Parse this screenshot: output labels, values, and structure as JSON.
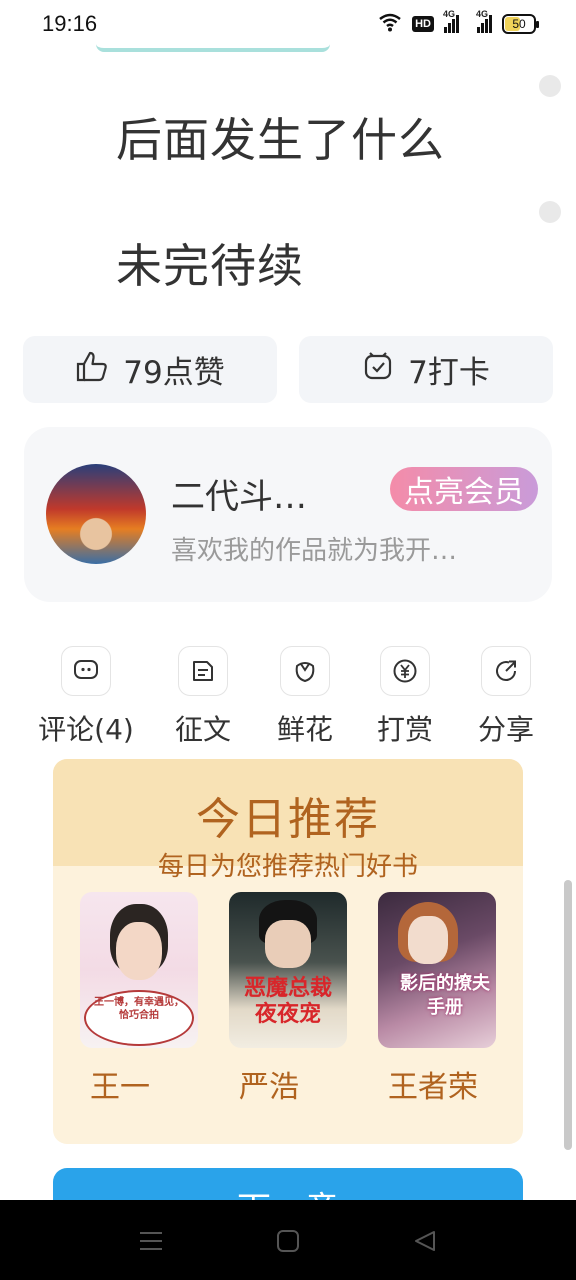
{
  "status_bar": {
    "time": "19:16",
    "hd": "HD",
    "net1": "4G",
    "net2": "4G",
    "battery": "50"
  },
  "story": {
    "line1": "后面发生了什么",
    "line2": "未完待续"
  },
  "actions": {
    "like_label": "79点赞",
    "checkin_label": "7打卡"
  },
  "author": {
    "name": "二代斗…",
    "subtitle": "喜欢我的作品就为我开…",
    "vip_label": "点亮会员"
  },
  "tools": [
    {
      "label": "评论(4)",
      "icon": "comment-icon"
    },
    {
      "label": "征文",
      "icon": "essay-icon"
    },
    {
      "label": "鲜花",
      "icon": "flower-icon"
    },
    {
      "label": "打赏",
      "icon": "reward-icon"
    },
    {
      "label": "分享",
      "icon": "share-icon"
    }
  ],
  "recommend": {
    "title": "今日推荐",
    "subtitle": "每日为您推荐热门好书",
    "books": [
      {
        "title": "王一",
        "cover_text": "王一博，有幸遇见，恰巧合拍"
      },
      {
        "title": "严浩",
        "cover_text": "恶魔总裁夜夜宠"
      },
      {
        "title": "王者荣",
        "cover_text": "影后的撩夫手册"
      }
    ]
  },
  "next_button": {
    "label": "下一章"
  },
  "colors": {
    "accent_blue": "#2aa3ea",
    "recommend_brown": "#b0631f",
    "vip_pink": "#f48ca9"
  }
}
